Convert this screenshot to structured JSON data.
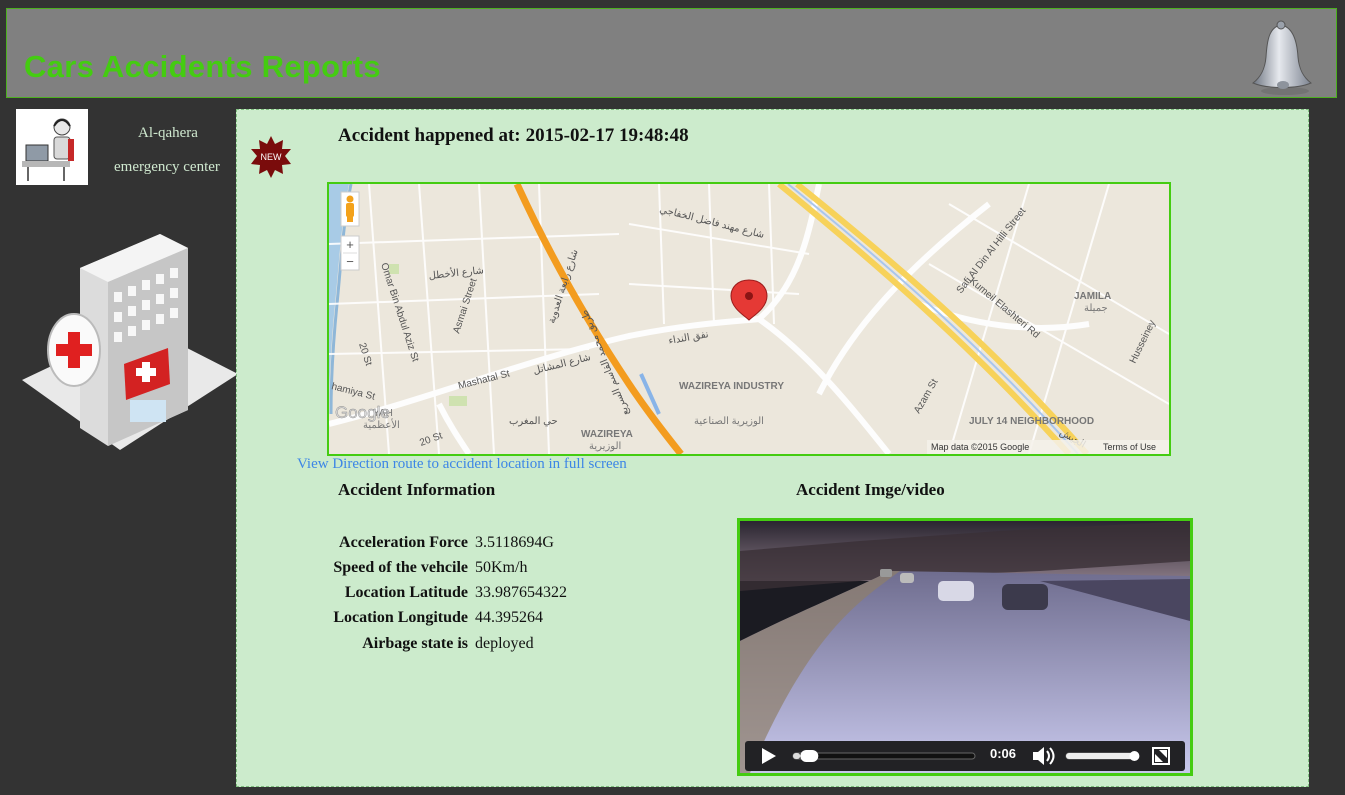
{
  "header": {
    "title": "Cars Accidents Reports"
  },
  "sidebar": {
    "center_name_line1": "Al-qahera",
    "center_name_line2": "emergency center"
  },
  "report": {
    "badge": "NEW",
    "time_label": "Accident happened at:",
    "time_value": "2015-02-17 19:48:48",
    "direction_link": "View Direction route to accident location in full screen",
    "info_title": "Accident Information",
    "media_title": "Accident Imge/video",
    "fields": [
      {
        "label": "Acceleration Force",
        "value": "3.5118694G"
      },
      {
        "label": "Speed of the vehcile",
        "value": "50Km/h"
      },
      {
        "label": "Location Latitude",
        "value": "33.987654322"
      },
      {
        "label": "Location Longitude",
        "value": "44.395264"
      },
      {
        "label": "Airbage state is",
        "value": "deployed"
      }
    ]
  },
  "map": {
    "zoom_in": "+",
    "zoom_out": "−",
    "google_logo": "Google",
    "attribution": "Map data ©2015 Google",
    "terms": "Terms of Use",
    "labels": {
      "industry": "WAZIREYA INDUSTRY",
      "industry_ar": "الوزيرية الصناعية",
      "wazireya": "WAZIREYA",
      "wazireya_ar": "الوزيرية",
      "jamila": "JAMILA",
      "jamila_ar": "جميلة",
      "july14": "JULY 14 NEIGHBORHOOD",
      "mashatal": "Mashatal St",
      "mashatal_ar": "شارع المشاتل",
      "omar": "Omar Bin Abdul Aziz St",
      "asmai": "Asmai Street",
      "safi": "Safi Al Din Al Hilli Street",
      "kumeil": "Kumeil Elashteri Rd",
      "azam": "Azam St",
      "husseiney": "Husseiney",
      "st20": "20 St",
      "st20b": "20 St",
      "hamiya": "hamiya St",
      "nafaq_ar": "نفق النداء",
      "ahtal_ar": "شارع الأخطل",
      "fadhil_ar": "شارع مهند فاضل الخفاجي",
      "rabia_ar": "شارع رابعة العدوية",
      "maghrib_ar": "حي المغرب",
      "mohammed_ar": "طريق محمد القاسم السريع",
      "jam_ar": "الجيش",
      "azamiya": "YAH",
      "azamiya_ar": "الأعظمية"
    }
  },
  "video": {
    "current_time": "0:06",
    "progress": 0.04,
    "volume": 0.95
  },
  "colors": {
    "accent_green": "#44cc11",
    "panel_bg": "#ccebcc",
    "page_bg": "#333333",
    "link": "#3d86e6",
    "badge": "#7a0c0c"
  }
}
